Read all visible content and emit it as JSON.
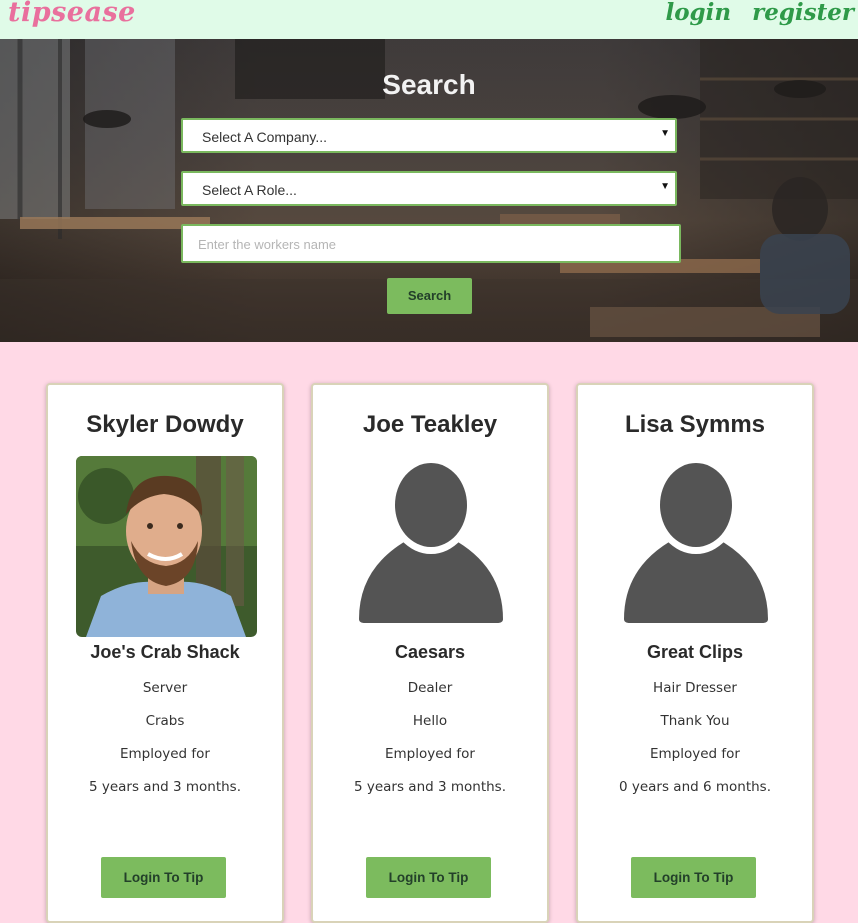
{
  "header": {
    "logo": "tipsease",
    "nav": {
      "login": "login",
      "register": "register"
    }
  },
  "search": {
    "title": "Search",
    "company_select": "Select A Company...",
    "role_select": "Select A Role...",
    "name_placeholder": "Enter the workers name",
    "button": "Search"
  },
  "colors": {
    "accent_green": "#7cbb5e",
    "logo_pink": "#e9709d",
    "nav_green": "#2f9a49",
    "page_pink": "#ffd9e6",
    "header_mint": "#e0fbe8"
  },
  "workers": [
    {
      "name": "Skyler Dowdy",
      "photo": "worker-photo",
      "company": "Joe's Crab Shack",
      "role": "Server",
      "tagline": "Crabs",
      "employed_label": "Employed for",
      "duration": "5 years and 3 months.",
      "button": "Login To Tip"
    },
    {
      "name": "Joe Teakley",
      "photo": "default-avatar-icon",
      "company": "Caesars",
      "role": "Dealer",
      "tagline": "Hello",
      "employed_label": "Employed for",
      "duration": "5 years and 3 months.",
      "button": "Login To Tip"
    },
    {
      "name": "Lisa Symms",
      "photo": "default-avatar-icon",
      "company": "Great Clips",
      "role": "Hair Dresser",
      "tagline": "Thank You",
      "employed_label": "Employed for",
      "duration": "0 years and 6 months.",
      "button": "Login To Tip"
    }
  ]
}
